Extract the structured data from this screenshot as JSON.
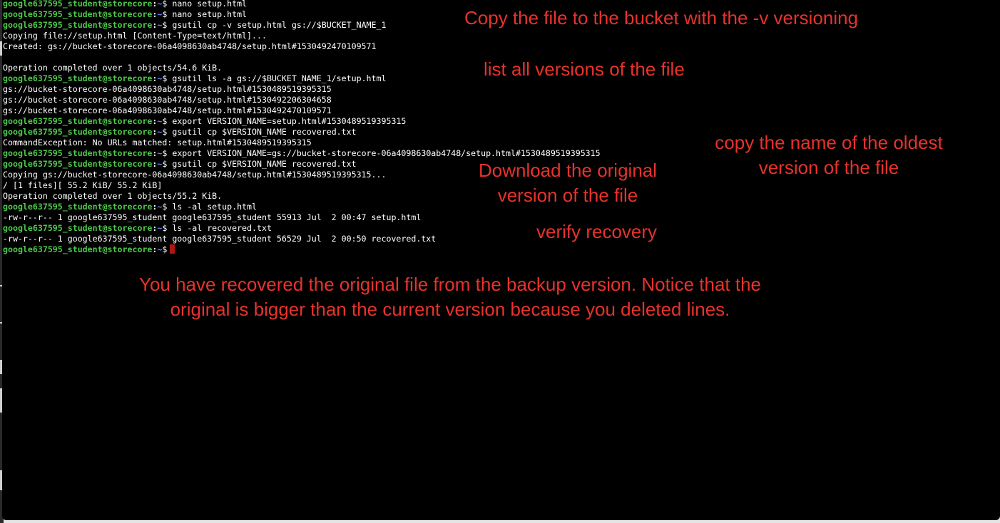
{
  "terminal": {
    "prompt_user": "google637595_student@storecore",
    "prompt_path": "~",
    "prompt_sign": "$",
    "lines": [
      {
        "type": "prompt",
        "command": "nano setup.html"
      },
      {
        "type": "prompt",
        "command": "nano setup.html"
      },
      {
        "type": "prompt",
        "command": "gsutil cp -v setup.html gs://$BUCKET_NAME_1"
      },
      {
        "type": "output",
        "text": "Copying file://setup.html [Content-Type=text/html]..."
      },
      {
        "type": "output",
        "text": "Created: gs://bucket-storecore-06a4098630ab4748/setup.html#1530492470109571"
      },
      {
        "type": "output",
        "text": ""
      },
      {
        "type": "output",
        "text": "Operation completed over 1 objects/54.6 KiB."
      },
      {
        "type": "prompt",
        "command": "gsutil ls -a gs://$BUCKET_NAME_1/setup.html"
      },
      {
        "type": "output",
        "text": "gs://bucket-storecore-06a4098630ab4748/setup.html#1530489519395315"
      },
      {
        "type": "output",
        "text": "gs://bucket-storecore-06a4098630ab4748/setup.html#1530492206304658"
      },
      {
        "type": "output",
        "text": "gs://bucket-storecore-06a4098630ab4748/setup.html#1530492470109571"
      },
      {
        "type": "prompt",
        "command": "export VERSION_NAME=setup.html#1530489519395315"
      },
      {
        "type": "prompt",
        "command": "gsutil cp $VERSION_NAME recovered.txt"
      },
      {
        "type": "output",
        "text": "CommandException: No URLs matched: setup.html#1530489519395315"
      },
      {
        "type": "prompt",
        "command": "export VERSION_NAME=gs://bucket-storecore-06a4098630ab4748/setup.html#1530489519395315"
      },
      {
        "type": "prompt",
        "command": "gsutil cp $VERSION_NAME recovered.txt"
      },
      {
        "type": "output",
        "text": "Copying gs://bucket-storecore-06a4098630ab4748/setup.html#1530489519395315..."
      },
      {
        "type": "output",
        "text": "/ [1 files][ 55.2 KiB/ 55.2 KiB]"
      },
      {
        "type": "output",
        "text": "Operation completed over 1 objects/55.2 KiB."
      },
      {
        "type": "prompt",
        "command": "ls -al setup.html"
      },
      {
        "type": "output",
        "text": "-rw-r--r-- 1 google637595_student google637595_student 55913 Jul  2 00:47 setup.html"
      },
      {
        "type": "prompt",
        "command": "ls -al recovered.txt"
      },
      {
        "type": "output",
        "text": "-rw-r--r-- 1 google637595_student google637595_student 56529 Jul  2 00:50 recovered.txt"
      },
      {
        "type": "prompt",
        "command": "",
        "cursor": true
      }
    ]
  },
  "annotations": {
    "copy_versioning": "Copy the file to the bucket with the -v versioning",
    "list_versions": "list all versions of the file",
    "copy_oldest_line1": "copy the name of the oldest",
    "copy_oldest_line2": "version of the file",
    "download_original_line1": "Download the original",
    "download_original_line2": "version of the file",
    "verify_recovery": "verify recovery",
    "summary_line1": "You have recovered the original file from the backup version. Notice that the",
    "summary_line2": "original is bigger than the current version because you deleted lines."
  },
  "colors": {
    "terminal_bg": "#000000",
    "prompt_user": "#4ec94a",
    "prompt_path": "#5b8cff",
    "output_text": "#ffffff",
    "annotation": "#e8322c",
    "cursor": "#b01616"
  }
}
